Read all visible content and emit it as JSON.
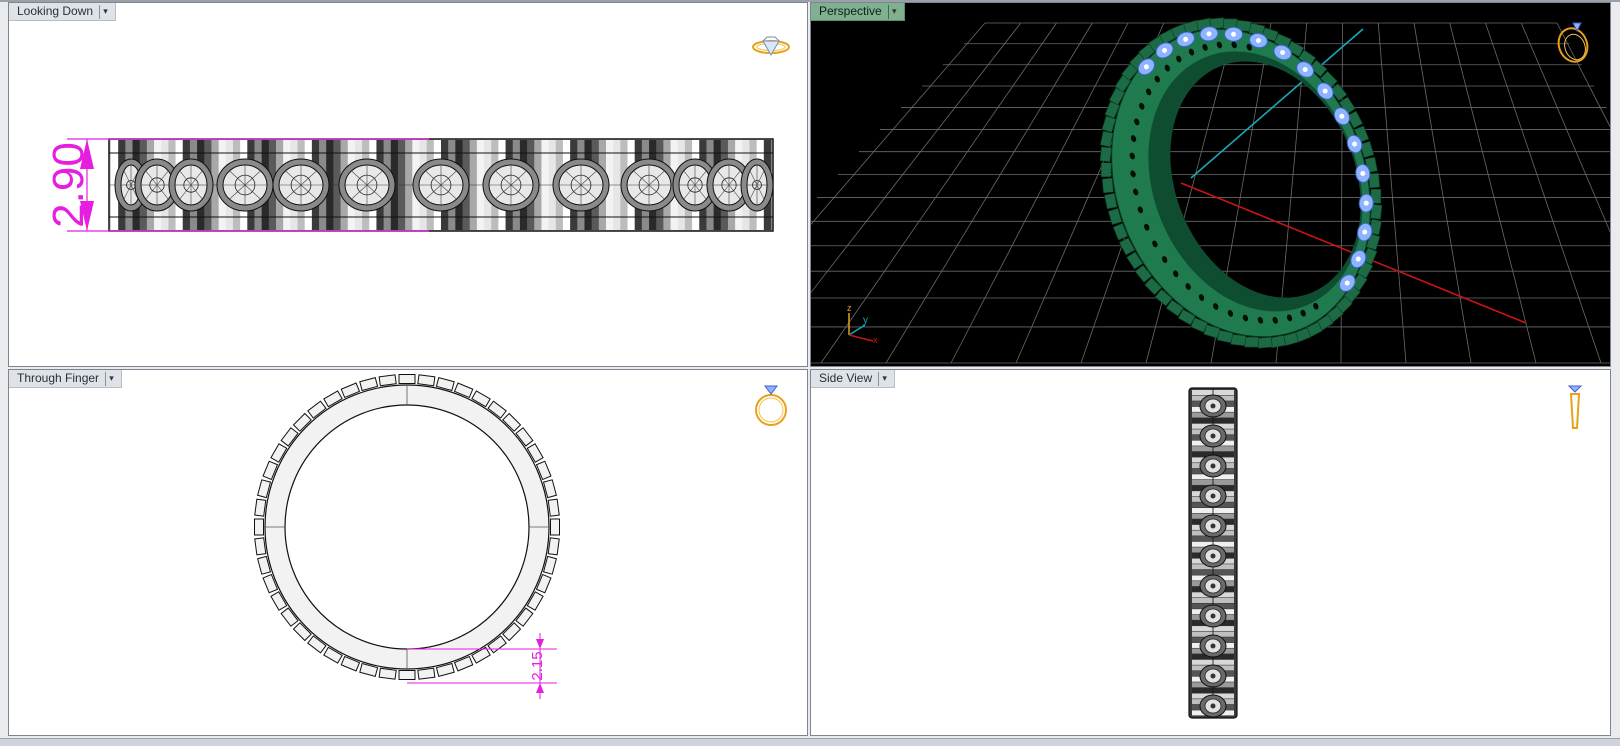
{
  "viewports": {
    "top": {
      "label": "Looking Down",
      "dimension": "2.90",
      "active": false
    },
    "perspective": {
      "label": "Perspective",
      "active": true,
      "axis_labels": {
        "z": "z",
        "y": "y",
        "x": "x"
      }
    },
    "front": {
      "label": "Through Finger",
      "dimension": "2.15",
      "active": false
    },
    "right": {
      "label": "Side View",
      "active": false
    }
  },
  "icons": {
    "top": "ring-top-view-icon",
    "perspective": "ring-perspective-icon",
    "front": "ring-front-view-icon",
    "right": "ring-side-view-icon"
  },
  "colors": {
    "dimension": "#e51ee0",
    "band_green": "#1f7a4e",
    "band_dark": "#0f4d31",
    "gem_blue": "#8fb4ff",
    "grid": "#6a6a6a",
    "axis_red": "#c81414",
    "axis_cyan": "#1aa7b8",
    "icon_gold": "#e8a21a",
    "active_tab": "#7fb090"
  }
}
